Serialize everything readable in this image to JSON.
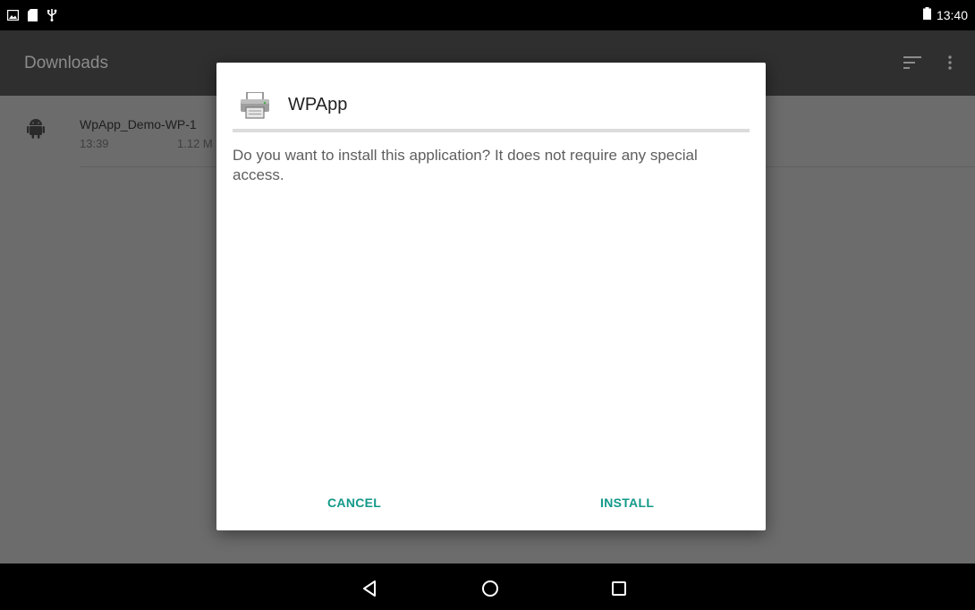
{
  "status_bar": {
    "left_icons": [
      "image-notification-icon",
      "sd-card-icon",
      "usb-icon"
    ],
    "battery_icon": "battery-icon",
    "time": "13:40"
  },
  "app_bar": {
    "title": "Downloads",
    "actions": [
      "sort-icon",
      "overflow-menu-icon"
    ]
  },
  "downloads": {
    "items": [
      {
        "icon": "android-robot-icon",
        "name": "WpApp_Demo-WP-1",
        "time": "13:39",
        "size": "1.12 M"
      }
    ]
  },
  "dialog": {
    "app_icon": "printer-icon",
    "title": "WPApp",
    "message": "Do you want to install this application? It does not require any special access.",
    "cancel_label": "CANCEL",
    "install_label": "INSTALL",
    "accent_color": "#13998a"
  },
  "nav_bar": {
    "buttons": [
      "back-icon",
      "home-icon",
      "recents-icon"
    ]
  }
}
